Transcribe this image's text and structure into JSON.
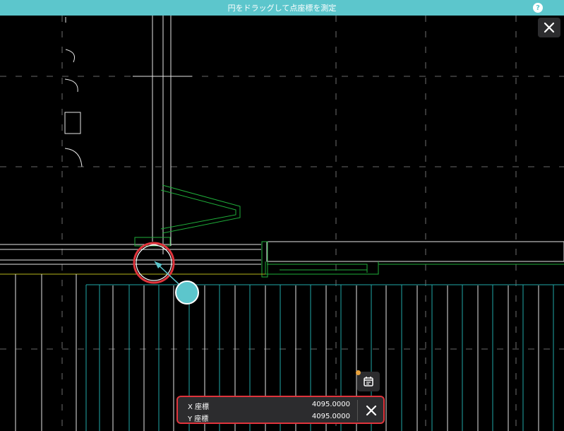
{
  "header": {
    "title": "円をドラッグして点座標を測定",
    "help_label": "?"
  },
  "measurement": {
    "x_label": "X 座標",
    "x_value": "4095.0000",
    "y_label": "Y 座標",
    "y_value": "4095.0000"
  },
  "icons": {
    "close": "close-icon",
    "help": "help-icon",
    "calendar": "calendar-icon"
  },
  "colors": {
    "header_bg": "#5cc6cc",
    "canvas_bg": "#000000",
    "highlight": "#e0343c",
    "handle": "#5cc6cc",
    "cad_white": "#e6e6e6",
    "cad_green": "#1fae3a",
    "cad_cyan": "#1fa7a7",
    "cad_yellow": "#b3b31a",
    "badge": "#e8a23c"
  }
}
